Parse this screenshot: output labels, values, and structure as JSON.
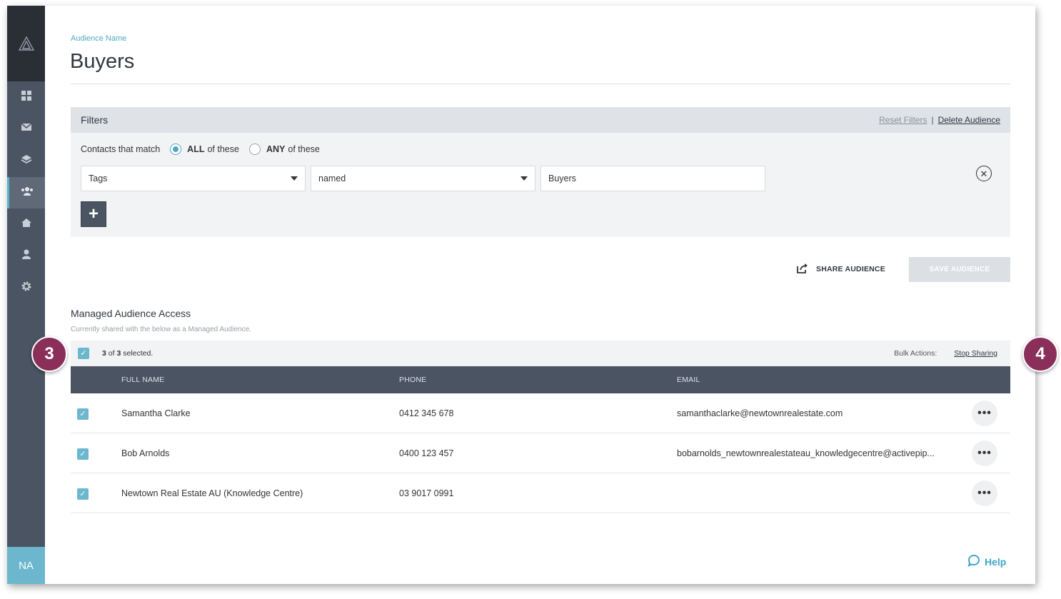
{
  "sidebar": {
    "logo_icon": "triangle-logo-icon",
    "items": [
      {
        "icon": "dashboard-icon",
        "active": false
      },
      {
        "icon": "mail-icon",
        "active": false
      },
      {
        "icon": "layers-icon",
        "active": false
      },
      {
        "icon": "audiences-icon",
        "active": true
      },
      {
        "icon": "home-icon",
        "active": false
      },
      {
        "icon": "person-icon",
        "active": false
      },
      {
        "icon": "gear-icon",
        "active": false
      }
    ],
    "avatar_initials": "NA"
  },
  "header": {
    "audience_label": "Audience Name",
    "title": "Buyers"
  },
  "filters": {
    "title": "Filters",
    "reset_label": "Reset Filters",
    "separator": "|",
    "delete_label": "Delete Audience",
    "match_label": "Contacts that match",
    "option_all_bold": "ALL",
    "option_all_rest": "of these",
    "option_any_bold": "ANY",
    "option_any_rest": "of these",
    "selected_option": "ALL",
    "field_select": "Tags",
    "operator_select": "named",
    "value_input": "Buyers",
    "add_label": "+"
  },
  "actions": {
    "share_label": "SHARE AUDIENCE",
    "save_label": "SAVE AUDIENCE"
  },
  "managed": {
    "title": "Managed Audience Access",
    "subtitle": "Currently shared with the below as a Managed Audience.",
    "selected_count": "3",
    "of_label": "of",
    "total_count": "3",
    "selected_suffix": "selected.",
    "bulk_label": "Bulk Actions:",
    "stop_label": "Stop Sharing"
  },
  "table": {
    "columns": [
      "FULL NAME",
      "PHONE",
      "EMAIL"
    ],
    "rows": [
      {
        "name": "Samantha Clarke",
        "phone": "0412 345 678",
        "email": "samanthaclarke@newtownrealestate.com",
        "checked": true
      },
      {
        "name": "Bob Arnolds",
        "phone": "0400 123 457",
        "email": "bobarnolds_newtownrealestateau_knowledgecentre@activepip...",
        "checked": true
      },
      {
        "name": "Newtown Real Estate AU (Knowledge Centre)",
        "phone": "03 9017 0991",
        "email": "",
        "checked": true
      }
    ],
    "more_label": "•••"
  },
  "help_label": "Help",
  "badges": {
    "left": "3",
    "right": "4"
  },
  "colors": {
    "accent": "#4fa8c4",
    "sidebar": "#4a5462",
    "badge": "#8a2e5a"
  }
}
